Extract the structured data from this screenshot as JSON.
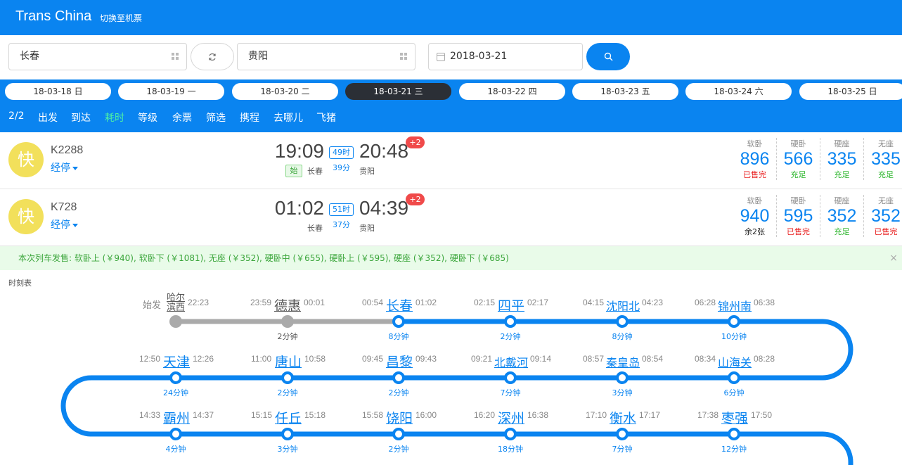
{
  "header": {
    "brand": "Trans China",
    "switch_label": "切换至机票"
  },
  "search": {
    "from": "长春",
    "to": "贵阳",
    "date": "2018-03-21",
    "icons": {
      "from": "grid-icon",
      "to": "grid-icon",
      "swap": "refresh-icon",
      "date": "calendar-icon",
      "search": "search-icon"
    }
  },
  "dates": [
    {
      "label": "18-03-18 日",
      "active": false
    },
    {
      "label": "18-03-19 一",
      "active": false
    },
    {
      "label": "18-03-20 二",
      "active": false
    },
    {
      "label": "18-03-21 三",
      "active": true
    },
    {
      "label": "18-03-22 四",
      "active": false
    },
    {
      "label": "18-03-23 五",
      "active": false
    },
    {
      "label": "18-03-24 六",
      "active": false
    },
    {
      "label": "18-03-25 日",
      "active": false
    }
  ],
  "filters": {
    "page": "2/2",
    "items": [
      "出发",
      "到达",
      "耗时",
      "等级",
      "余票",
      "筛选",
      "携程",
      "去哪儿",
      "飞猪"
    ],
    "active": "耗时",
    "active_color": "#4df0a5"
  },
  "trains": [
    {
      "badge": "快",
      "number": "K2288",
      "stops_label": "经停",
      "dep_time": "19:09",
      "arr_time": "20:48",
      "dur_h": "49时",
      "dur_m": "39分",
      "origin_tag": "始",
      "from": "长春",
      "to": "贵阳",
      "day_plus": "+2",
      "seats": [
        {
          "name": "软卧",
          "price": "896",
          "status": "已售完",
          "status_type": "red"
        },
        {
          "name": "硬卧",
          "price": "566",
          "status": "充足",
          "status_type": "green"
        },
        {
          "name": "硬座",
          "price": "335",
          "status": "充足",
          "status_type": "green"
        },
        {
          "name": "无座",
          "price": "335",
          "status": "充足",
          "status_type": "green"
        }
      ]
    },
    {
      "badge": "快",
      "number": "K728",
      "stops_label": "经停",
      "dep_time": "01:02",
      "arr_time": "04:39",
      "dur_h": "51时",
      "dur_m": "37分",
      "origin_tag": "",
      "from": "长春",
      "to": "贵阳",
      "day_plus": "+2",
      "seats": [
        {
          "name": "软卧",
          "price": "940",
          "status": "余2张",
          "status_type": "black"
        },
        {
          "name": "硬卧",
          "price": "595",
          "status": "已售完",
          "status_type": "red"
        },
        {
          "name": "硬座",
          "price": "352",
          "status": "充足",
          "status_type": "green"
        },
        {
          "name": "无座",
          "price": "352",
          "status": "已售完",
          "status_type": "red"
        }
      ]
    }
  ],
  "notice": {
    "text": "本次列车发售: 软卧上 (￥940), 软卧下 (￥1081), 无座 (￥352), 硬卧中 (￥655), 硬卧上 (￥595), 硬座 (￥352), 硬卧下 (￥685)",
    "close": "×"
  },
  "timetable": {
    "title": "时刻表",
    "rows": [
      [
        {
          "name": "哈尔滨西",
          "arr": "始发",
          "dep": "22:23",
          "dur": "",
          "passed": true,
          "twoline": true
        },
        {
          "name": "德惠",
          "arr": "23:59",
          "dep": "00:01",
          "dur": "2分钟",
          "passed": true
        },
        {
          "name": "长春",
          "arr": "00:54",
          "dep": "01:02",
          "dur": "8分钟",
          "passed": false
        },
        {
          "name": "四平",
          "arr": "02:15",
          "dep": "02:17",
          "dur": "2分钟",
          "passed": false
        },
        {
          "name": "沈阳北",
          "arr": "04:15",
          "dep": "04:23",
          "dur": "8分钟",
          "passed": false
        },
        {
          "name": "锦州南",
          "arr": "06:28",
          "dep": "06:38",
          "dur": "10分钟",
          "passed": false
        }
      ],
      [
        {
          "name": "天津",
          "arr": "12:50",
          "dep": "12:26",
          "dur": "24分钟"
        },
        {
          "name": "唐山",
          "arr": "11:00",
          "dep": "10:58",
          "dur": "2分钟"
        },
        {
          "name": "昌黎",
          "arr": "09:45",
          "dep": "09:43",
          "dur": "2分钟"
        },
        {
          "name": "北戴河",
          "arr": "09:21",
          "dep": "09:14",
          "dur": "7分钟"
        },
        {
          "name": "秦皇岛",
          "arr": "08:57",
          "dep": "08:54",
          "dur": "3分钟"
        },
        {
          "name": "山海关",
          "arr": "08:34",
          "dep": "08:28",
          "dur": "6分钟"
        }
      ],
      [
        {
          "name": "霸州",
          "arr": "14:33",
          "dep": "14:37",
          "dur": "4分钟"
        },
        {
          "name": "任丘",
          "arr": "15:15",
          "dep": "15:18",
          "dur": "3分钟"
        },
        {
          "name": "饶阳",
          "arr": "15:58",
          "dep": "16:00",
          "dur": "2分钟"
        },
        {
          "name": "深州",
          "arr": "16:20",
          "dep": "16:38",
          "dur": "18分钟"
        },
        {
          "name": "衡水",
          "arr": "17:10",
          "dep": "17:17",
          "dur": "7分钟"
        },
        {
          "name": "枣强",
          "arr": "17:38",
          "dep": "17:50",
          "dur": "12分钟"
        }
      ]
    ]
  },
  "colors": {
    "primary": "#0a84f0",
    "kuai": "#f2e05b",
    "red": "#e81b1b",
    "green": "#29b529",
    "passed": "#aaaaaa"
  }
}
